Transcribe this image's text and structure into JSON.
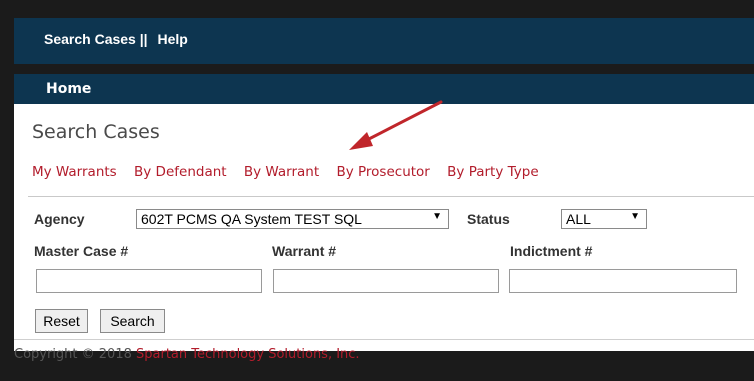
{
  "topnav": {
    "search_cases": "Search Cases",
    "separator": "||",
    "help": "Help"
  },
  "homebar": {
    "home": "Home"
  },
  "page": {
    "title": "Search Cases"
  },
  "tabs": [
    "My Warrants",
    "By Defendant",
    "By Warrant",
    "By Prosecutor",
    "By Party Type"
  ],
  "form": {
    "agency_label": "Agency",
    "agency_value": "602T PCMS QA System TEST SQL",
    "status_label": "Status",
    "status_value": "ALL",
    "master_case_label": "Master Case #",
    "warrant_label": "Warrant #",
    "indictment_label": "Indictment #",
    "master_case_value": "",
    "warrant_value": "",
    "indictment_value": ""
  },
  "buttons": {
    "reset": "Reset",
    "search": "Search"
  },
  "footer": {
    "prefix": "Copyright © 2018 ",
    "company": "Spartan Technology Solutions, Inc."
  },
  "colors": {
    "nav_bg": "#0d3550",
    "link": "#b21c2b",
    "annotation_arrow": "#c0262b"
  }
}
